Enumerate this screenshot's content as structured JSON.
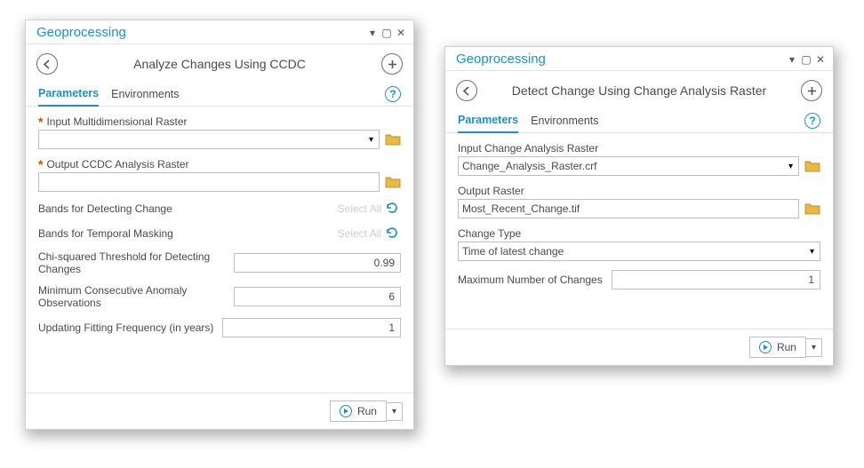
{
  "left": {
    "window_title": "Geoprocessing",
    "tool_title": "Analyze Changes Using CCDC",
    "tabs": {
      "parameters": "Parameters",
      "environments": "Environments"
    },
    "fields": {
      "input_md_raster": {
        "label": "Input Multidimensional Raster",
        "value": ""
      },
      "output_ccdc": {
        "label": "Output CCDC Analysis Raster",
        "value": ""
      },
      "bands_change": {
        "label": "Bands for Detecting Change",
        "select_all": "Select All"
      },
      "bands_mask": {
        "label": "Bands for Temporal Masking",
        "select_all": "Select All"
      },
      "chi_sq": {
        "label": "Chi-squared Threshold for Detecting Changes",
        "value": "0.99"
      },
      "min_consec": {
        "label": "Minimum Consecutive Anomaly Observations",
        "value": "6"
      },
      "update_freq": {
        "label": "Updating Fitting Frequency (in years)",
        "value": "1"
      }
    },
    "run_label": "Run"
  },
  "right": {
    "window_title": "Geoprocessing",
    "tool_title": "Detect Change Using Change Analysis Raster",
    "tabs": {
      "parameters": "Parameters",
      "environments": "Environments"
    },
    "fields": {
      "input_car": {
        "label": "Input Change Analysis Raster",
        "value": "Change_Analysis_Raster.crf"
      },
      "output_ras": {
        "label": "Output Raster",
        "value": "Most_Recent_Change.tif"
      },
      "change_type": {
        "label": "Change Type",
        "value": "Time  of latest change"
      },
      "max_changes": {
        "label": "Maximum Number of Changes",
        "value": "1"
      }
    },
    "run_label": "Run"
  }
}
